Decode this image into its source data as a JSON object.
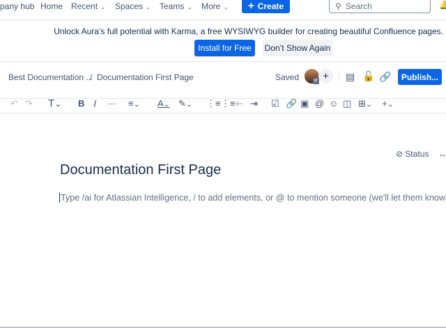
{
  "nav": {
    "hub": "pany hub",
    "home": "Home",
    "recent": "Recent",
    "spaces": "Spaces",
    "teams": "Teams",
    "more": "More",
    "create": "Create",
    "search_placeholder": "Search"
  },
  "banner": {
    "text": "Unlock Aura’s full potential with Karma, a free WYSIWYG builder for creating beautiful Confluence pages.",
    "install": "Install for Free",
    "dismiss": "Don’t Show Again"
  },
  "breadcrumb": {
    "space": "Best Documentation ...",
    "sep": "/",
    "page": "Documentation First Page"
  },
  "header": {
    "saved": "Saved",
    "avatar_badge": "P",
    "publish": "Publish..."
  },
  "editor": {
    "status": "Status",
    "title": "Documentation First Page",
    "placeholder": "Type /ai for Atlassian Intelligence, / to add elements, or @ to mention someone (we'll let them know)."
  }
}
